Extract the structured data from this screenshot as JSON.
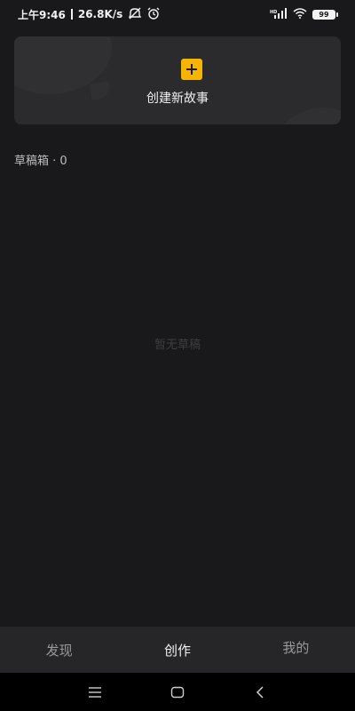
{
  "status_bar": {
    "time": "上午9:46",
    "network_speed": "26.8K/s",
    "battery": "99",
    "icons": [
      "mute-icon",
      "alarm-icon",
      "hd-signal-icon",
      "wifi-icon",
      "battery-icon"
    ]
  },
  "create_card": {
    "label": "创建新故事",
    "icon": "plus-icon",
    "accent_color": "#f7b500"
  },
  "drafts": {
    "header": "草稿箱 · 0",
    "empty_text": "暂无草稿"
  },
  "tabs": [
    {
      "label": "发现",
      "active": false
    },
    {
      "label": "创作",
      "active": true
    },
    {
      "label": "我的",
      "active": false
    }
  ],
  "nav": {
    "icons": [
      "menu-icon",
      "home-icon",
      "back-icon"
    ]
  }
}
